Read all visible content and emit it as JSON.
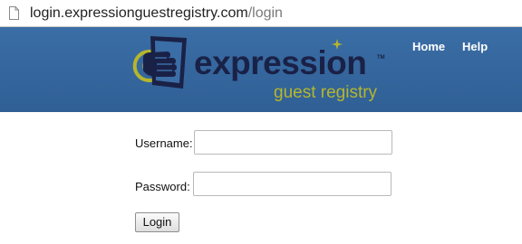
{
  "browser": {
    "url_host": "login.expressionguestregistry.com",
    "url_path": "/login",
    "page_icon": "document-icon"
  },
  "header": {
    "logo": {
      "word": "expression",
      "trademark": "TM",
      "tagline": "guest registry"
    },
    "nav": {
      "home": "Home",
      "help": "Help"
    }
  },
  "login_form": {
    "username_label": "Username:",
    "username_value": "",
    "password_label": "Password:",
    "password_value": "",
    "submit_label": "Login"
  },
  "colors": {
    "header_blue": "#3b6ea6",
    "logo_navy": "#1a2147",
    "logo_olive": "#b6b62c"
  }
}
